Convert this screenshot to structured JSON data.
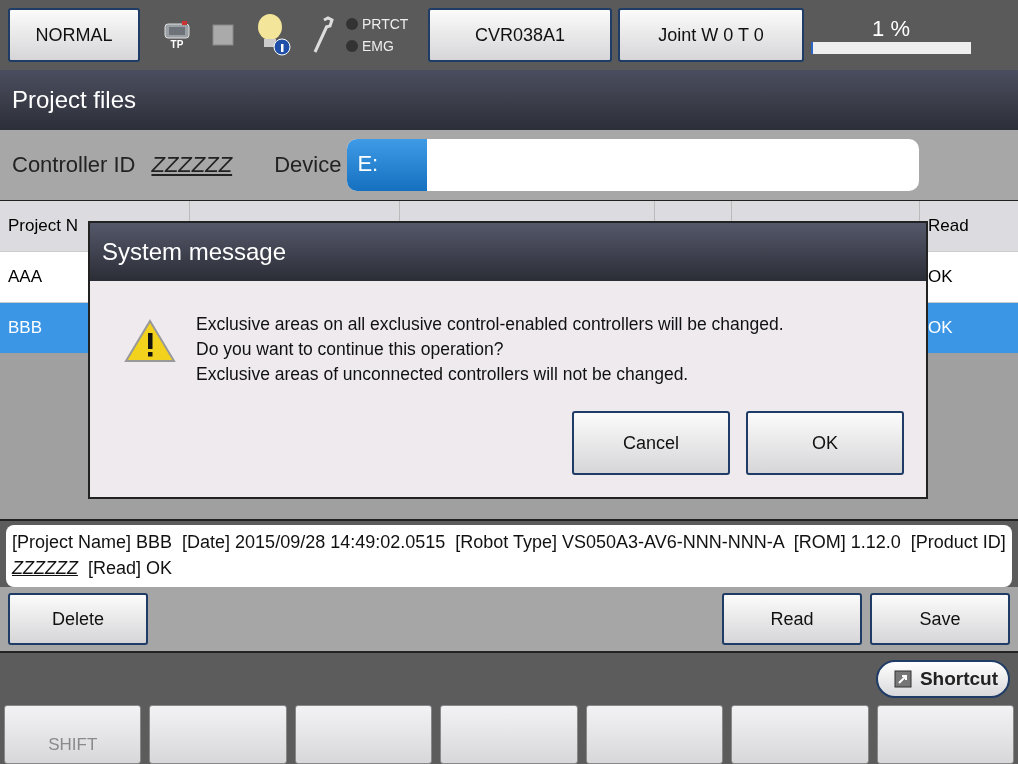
{
  "top_bar": {
    "mode_button": "NORMAL",
    "tp_label": "TP",
    "lamps": [
      {
        "label": "PRTCT",
        "on": false
      },
      {
        "label": "EMG",
        "on": false
      }
    ],
    "robot_button": "CVR038A1",
    "coord_button": "Joint  W 0 T 0",
    "speed": {
      "reading": "1 %",
      "level": 0.01
    }
  },
  "title": "Project files",
  "controller": {
    "label": "Controller ID",
    "value": "ZZZZZZ"
  },
  "device": {
    "label": "Device",
    "drive": "E:"
  },
  "table": {
    "columns": [
      {
        "label": "Project N"
      },
      {
        "label": "Read"
      }
    ],
    "rows": [
      {
        "name": "AAA",
        "read": "OK",
        "selected": false
      },
      {
        "name": "BBB",
        "read": "OK",
        "selected": true
      }
    ]
  },
  "detail": {
    "text": "[Project Name] BBB  [Date] 2015/09/28 14:49:02.0515  [Robot Type] VS050A3-AV6-NNN-NNN-A  [ROM] 1.12.0  [Product ID]",
    "product_id": "ZZZZZZ",
    "tail": "[Read] OK"
  },
  "actions": {
    "left": [
      "Delete"
    ],
    "right": [
      "Read",
      "Save"
    ]
  },
  "shortcut": "Shortcut",
  "function_keys": [
    {
      "label": "SHIFT",
      "disabled": true
    }
  ],
  "dialog": {
    "title": "System message",
    "lines": [
      "Exclusive areas on all exclusive control-enabled controllers will be changed.",
      "Do you want to continue this operation?",
      "Exclusive areas of unconnected controllers will not be changed."
    ],
    "buttons": [
      "Cancel",
      "OK"
    ]
  }
}
